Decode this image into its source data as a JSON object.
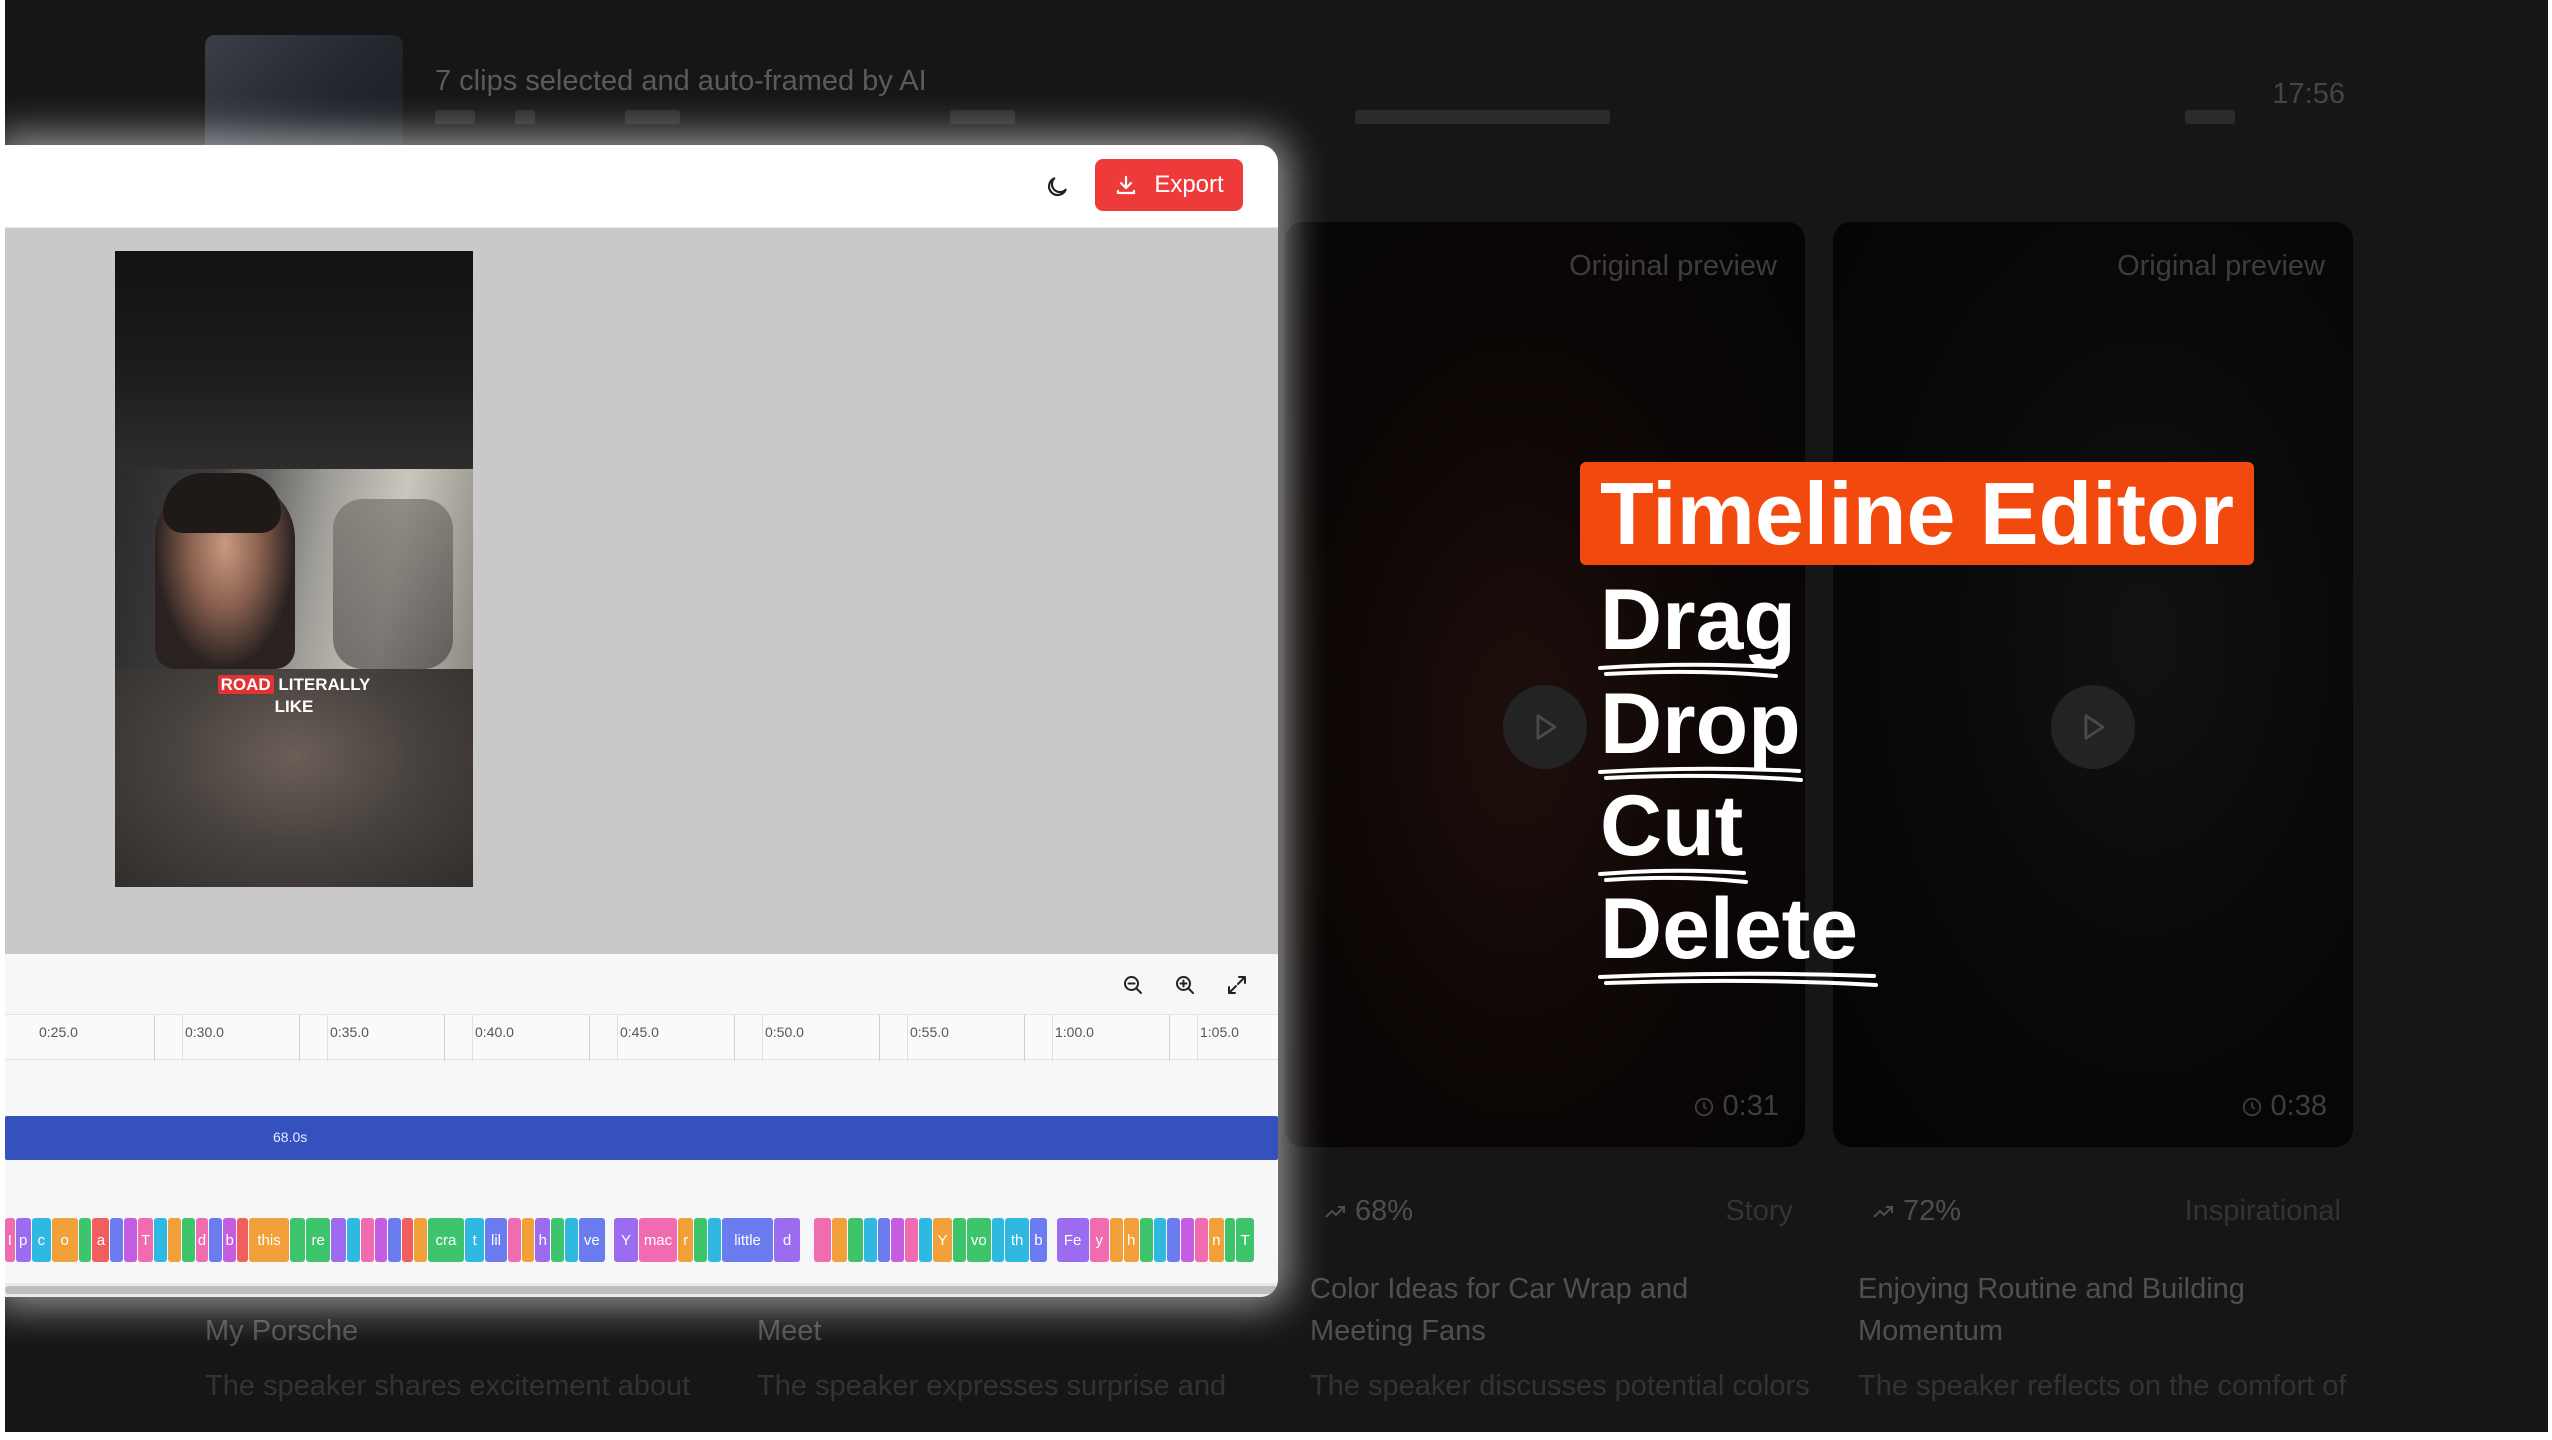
{
  "background": {
    "row": {
      "title": "7 clips selected and auto-framed by AI",
      "duration": "17:56"
    },
    "cards": [
      {
        "label": "Original preview",
        "duration": "0:31",
        "score": "68%",
        "category": "Story",
        "title": "Color Ideas for Car Wrap and Meeting Fans",
        "description": "The speaker discusses potential colors for wrapping their car and"
      },
      {
        "label": "Original preview",
        "duration": "0:38",
        "score": "72%",
        "category": "Inspirational",
        "title": "Enjoying Routine and Building Momentum",
        "description": "The speaker reflects on the comfort of routine and the importance of"
      }
    ],
    "partial_cards": [
      {
        "title_tail": "My Porsche",
        "description": "The speaker shares excitement about attending their first car mee"
      },
      {
        "title_tail": "Meet",
        "description": "The speaker expresses surprise and excitement about their car"
      }
    ]
  },
  "editor": {
    "export_label": "Export",
    "caption": {
      "highlight": "ROAD",
      "line1_rest": " LITERALLY",
      "line2": "LIKE"
    },
    "timeline": {
      "ticks": [
        "0:25.0",
        "0:30.0",
        "0:35.0",
        "0:40.0",
        "0:45.0",
        "0:50.0",
        "0:55.0",
        "1:00.0",
        "1:05.0"
      ],
      "main_clip_label": "68.0s",
      "words": [
        {
          "t": "I",
          "c": "#f06bb0",
          "w": 9
        },
        {
          "t": "p",
          "c": "#9b6cf0",
          "w": 14
        },
        {
          "t": "c",
          "c": "#2fb8e0",
          "w": 18
        },
        {
          "t": "o",
          "c": "#f2a13a",
          "w": 24
        },
        {
          "t": "",
          "c": "#3ec46d",
          "w": 12
        },
        {
          "t": "a",
          "c": "#f25d5d",
          "w": 16
        },
        {
          "t": "",
          "c": "#6b7cf0",
          "w": 12
        },
        {
          "t": "",
          "c": "#c45de0",
          "w": 12
        },
        {
          "t": "T",
          "c": "#f06bb0",
          "w": 14
        },
        {
          "t": "",
          "c": "#2fb8e0",
          "w": 12
        },
        {
          "t": "",
          "c": "#f2a13a",
          "w": 12
        },
        {
          "t": "",
          "c": "#3ec46d",
          "w": 12
        },
        {
          "t": "d",
          "c": "#f06bb0",
          "w": 12
        },
        {
          "t": "",
          "c": "#6b7cf0",
          "w": 12
        },
        {
          "t": "b",
          "c": "#c45de0",
          "w": 12
        },
        {
          "t": "",
          "c": "#f25d5d",
          "w": 10
        },
        {
          "t": "this",
          "c": "#f2a13a",
          "w": 38
        },
        {
          "t": "",
          "c": "#3ec46d",
          "w": 14
        },
        {
          "t": "re",
          "c": "#3ec46d",
          "w": 22
        },
        {
          "t": "",
          "c": "#9b6cf0",
          "w": 14
        },
        {
          "t": "",
          "c": "#2fb8e0",
          "w": 12
        },
        {
          "t": "",
          "c": "#f06bb0",
          "w": 12
        },
        {
          "t": "",
          "c": "#c45de0",
          "w": 12
        },
        {
          "t": "",
          "c": "#6b7cf0",
          "w": 12
        },
        {
          "t": "",
          "c": "#f25d5d",
          "w": 10
        },
        {
          "t": "",
          "c": "#f2a13a",
          "w": 12
        },
        {
          "t": "cra",
          "c": "#3ec46d",
          "w": 34
        },
        {
          "t": "t",
          "c": "#2fb8e0",
          "w": 18
        },
        {
          "t": "lil",
          "c": "#6b7cf0",
          "w": 20
        },
        {
          "t": "",
          "c": "#f06bb0",
          "w": 12
        },
        {
          "t": "",
          "c": "#f2a13a",
          "w": 12
        },
        {
          "t": "h",
          "c": "#9b6cf0",
          "w": 14
        },
        {
          "t": "",
          "c": "#3ec46d",
          "w": 12
        },
        {
          "t": "",
          "c": "#2fb8e0",
          "w": 12
        },
        {
          "t": "ve",
          "c": "#6b7cf0",
          "w": 24
        },
        {
          "t": "",
          "c": "#ffffff",
          "w": 8
        },
        {
          "t": "Y",
          "c": "#9b6cf0",
          "w": 22
        },
        {
          "t": "mac",
          "c": "#f06bb0",
          "w": 36
        },
        {
          "t": "r",
          "c": "#f2a13a",
          "w": 14
        },
        {
          "t": "",
          "c": "#3ec46d",
          "w": 12
        },
        {
          "t": "",
          "c": "#2fb8e0",
          "w": 12
        },
        {
          "t": "little",
          "c": "#6b7cf0",
          "w": 48
        },
        {
          "t": "d",
          "c": "#9b6cf0",
          "w": 24
        },
        {
          "t": "",
          "c": "#ffffff",
          "w": 12
        },
        {
          "t": "",
          "c": "#f06bb0",
          "w": 16
        },
        {
          "t": "",
          "c": "#f2a13a",
          "w": 14
        },
        {
          "t": "",
          "c": "#3ec46d",
          "w": 14
        },
        {
          "t": "",
          "c": "#2fb8e0",
          "w": 12
        },
        {
          "t": "",
          "c": "#6b7cf0",
          "w": 12
        },
        {
          "t": "",
          "c": "#c45de0",
          "w": 12
        },
        {
          "t": "",
          "c": "#f06bb0",
          "w": 12
        },
        {
          "t": "",
          "c": "#2fb8e0",
          "w": 12
        },
        {
          "t": "Y",
          "c": "#f2a13a",
          "w": 18
        },
        {
          "t": "",
          "c": "#3ec46d",
          "w": 12
        },
        {
          "t": "vo",
          "c": "#3ec46d",
          "w": 22
        },
        {
          "t": "",
          "c": "#2fb8e0",
          "w": 12
        },
        {
          "t": "th",
          "c": "#2fb8e0",
          "w": 22
        },
        {
          "t": "b",
          "c": "#6b7cf0",
          "w": 16
        },
        {
          "t": "",
          "c": "#ffffff",
          "w": 8
        },
        {
          "t": "Fe",
          "c": "#9b6cf0",
          "w": 30
        },
        {
          "t": "y",
          "c": "#f06bb0",
          "w": 18
        },
        {
          "t": "",
          "c": "#f2a13a",
          "w": 12
        },
        {
          "t": "h",
          "c": "#f2a13a",
          "w": 14
        },
        {
          "t": "",
          "c": "#3ec46d",
          "w": 12
        },
        {
          "t": "",
          "c": "#2fb8e0",
          "w": 12
        },
        {
          "t": "",
          "c": "#6b7cf0",
          "w": 12
        },
        {
          "t": "",
          "c": "#c45de0",
          "w": 12
        },
        {
          "t": "",
          "c": "#f06bb0",
          "w": 12
        },
        {
          "t": "n",
          "c": "#f2a13a",
          "w": 14
        },
        {
          "t": "",
          "c": "#3ec46d",
          "w": 10
        },
        {
          "t": "T",
          "c": "#3ec46d",
          "w": 16
        }
      ]
    }
  },
  "promo": {
    "title": "Timeline Editor",
    "items": [
      "Drag",
      "Drop",
      "Cut",
      "Delete"
    ],
    "accent": "#f24a0e"
  },
  "colors": {
    "export_button": "#ef3a3a",
    "main_track": "#3551bd"
  }
}
